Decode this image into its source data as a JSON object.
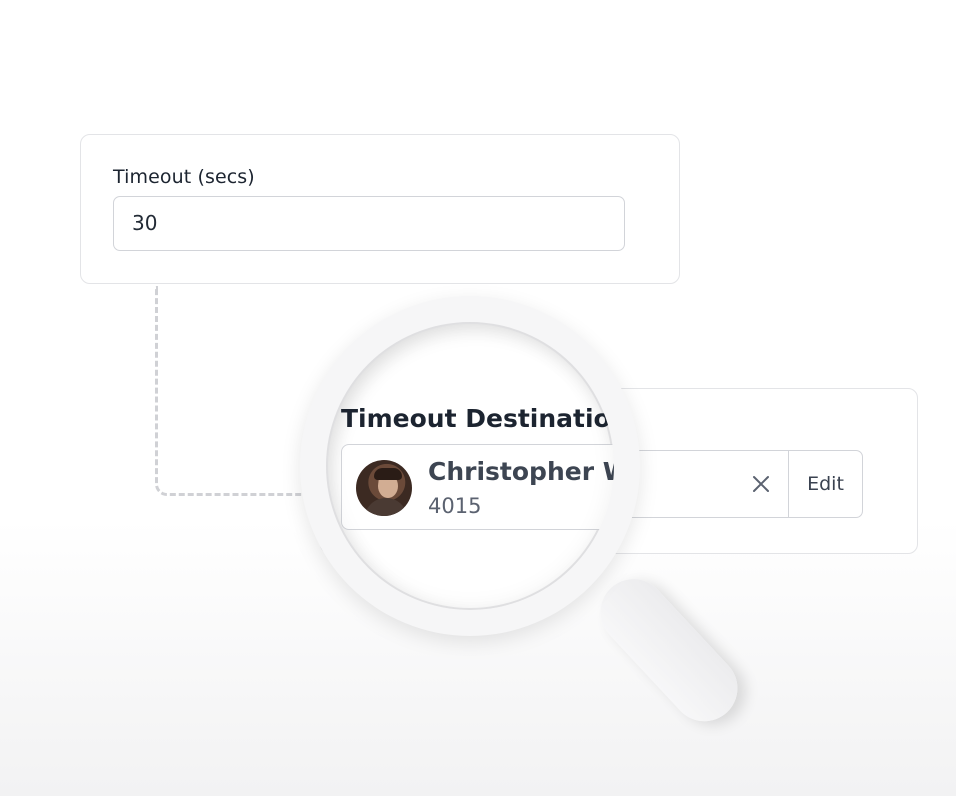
{
  "timeout": {
    "label": "Timeout (secs)",
    "value": "30"
  },
  "destination": {
    "label": "Timeout Destination",
    "contact_name": "Christopher W",
    "extension": "4015",
    "clear_label": "×",
    "edit_label": "Edit"
  },
  "icons": {
    "clear": "close-icon",
    "magnifier": "magnifier-icon",
    "avatar": "user-avatar"
  }
}
